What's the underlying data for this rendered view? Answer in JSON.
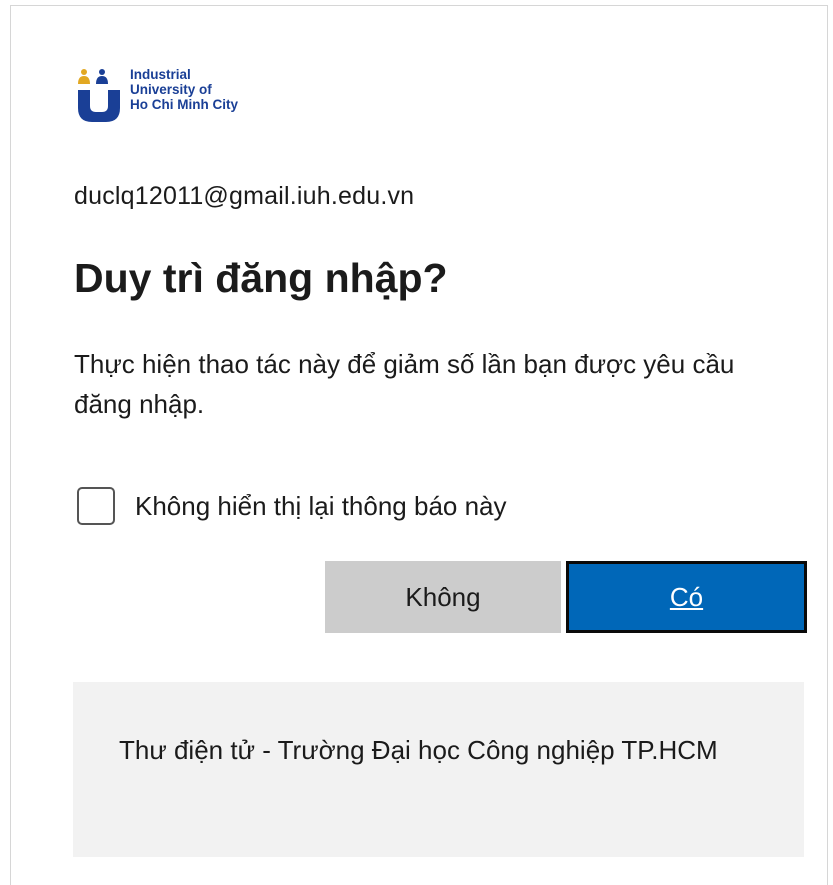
{
  "logo": {
    "lines": [
      "Industrial",
      "University of",
      "Ho Chi Minh City"
    ],
    "colors": {
      "navy": "#1a3f96",
      "gold": "#e2a822"
    }
  },
  "account": {
    "email": "duclq12011@gmail.iuh.edu.vn"
  },
  "dialog": {
    "title": "Duy trì đăng nhập?",
    "description": "Thực hiện thao tác này để giảm số lần bạn được yêu cầu đăng nhập.",
    "checkbox_label": "Không hiển thị lại thông báo này",
    "checkbox_checked": false,
    "no_button": "Không",
    "yes_button": "Có"
  },
  "footer": {
    "text": "Thư điện tử - Trường Đại học Công nghiệp TP.HCM"
  },
  "colors": {
    "primary": "#0067b8",
    "secondary_button": "#cccccc",
    "footer_bg": "#f2f2f2"
  }
}
